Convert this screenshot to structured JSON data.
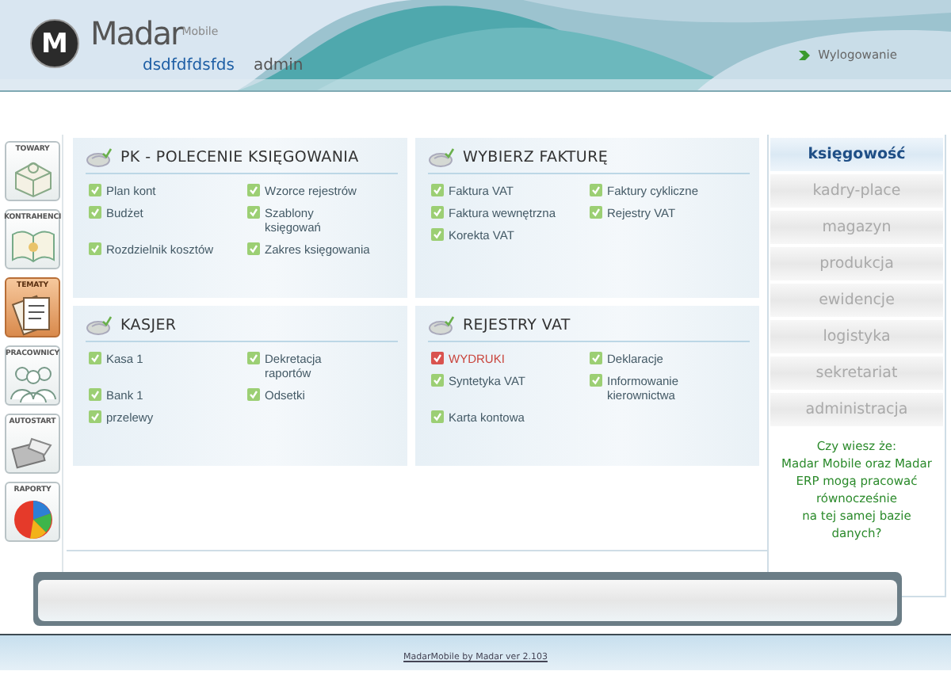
{
  "header": {
    "logo_mark": "M",
    "brand": "Madar",
    "brand_suffix": "Mobile",
    "company": "dsdfdfdsfds",
    "user": "admin",
    "logout": "Wylogowanie"
  },
  "tools": [
    {
      "label": "TOWARY",
      "selected": false
    },
    {
      "label": "KONTRAHENCI",
      "selected": false
    },
    {
      "label": "TEMATY",
      "selected": true
    },
    {
      "label": "PRACOWNICY",
      "selected": false
    },
    {
      "label": "AUTOSTART",
      "selected": false
    },
    {
      "label": "RAPORTY",
      "selected": false
    }
  ],
  "panels": [
    {
      "title": "PK - POLECENIE KSIĘGOWANIA",
      "items": [
        {
          "label": "Plan kont",
          "selected": false
        },
        {
          "label": "Wzorce rejestrów",
          "selected": false
        },
        {
          "label": "Budżet",
          "selected": false
        },
        {
          "label": "Szablony księgowań",
          "selected": false
        },
        {
          "label": "Rozdzielnik kosztów",
          "selected": false
        },
        {
          "label": "Zakres księgowania",
          "selected": false
        }
      ]
    },
    {
      "title": "WYBIERZ FAKTURĘ",
      "items": [
        {
          "label": "Faktura VAT",
          "selected": false
        },
        {
          "label": "Faktury cykliczne",
          "selected": false
        },
        {
          "label": "Faktura wewnętrzna",
          "selected": false
        },
        {
          "label": "Rejestry VAT",
          "selected": false
        },
        {
          "label": "Korekta VAT",
          "selected": false
        }
      ]
    },
    {
      "title": "KASJER",
      "items": [
        {
          "label": "Kasa 1",
          "selected": false
        },
        {
          "label": "Dekretacja raportów",
          "selected": false
        },
        {
          "label": "Bank 1",
          "selected": false
        },
        {
          "label": "Odsetki",
          "selected": false
        },
        {
          "label": "przelewy",
          "selected": false
        }
      ]
    },
    {
      "title": "REJESTRY VAT",
      "items": [
        {
          "label": "WYDRUKI",
          "selected": true
        },
        {
          "label": "Deklaracje",
          "selected": false
        },
        {
          "label": "Syntetyka VAT",
          "selected": false
        },
        {
          "label": "Informowanie kierownictwa",
          "selected": false
        },
        {
          "label": "Karta kontowa",
          "selected": false
        }
      ]
    }
  ],
  "modules": [
    {
      "label": "księgowość",
      "selected": true
    },
    {
      "label": "kadry-place",
      "selected": false
    },
    {
      "label": "magazyn",
      "selected": false
    },
    {
      "label": "produkcja",
      "selected": false
    },
    {
      "label": "ewidencje",
      "selected": false
    },
    {
      "label": "logistyka",
      "selected": false
    },
    {
      "label": "sekretariat",
      "selected": false
    },
    {
      "label": "administracja",
      "selected": false
    }
  ],
  "tip": "Czy wiesz że:\nMadar Mobile oraz Madar ERP mogą pracować równocześnie\nna tej samej bazie danych?",
  "footer": {
    "link": "MadarMobile by Madar ver 2.103"
  }
}
